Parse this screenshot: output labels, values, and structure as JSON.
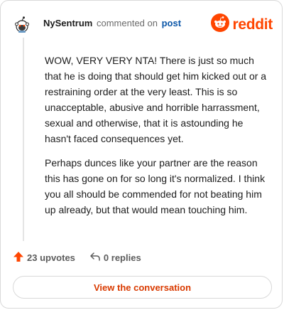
{
  "header": {
    "username": "NySentrum",
    "verb": "commented on",
    "post_link": "post",
    "brand_text": "reddit"
  },
  "comment": {
    "paragraphs": [
      "WOW, VERY VERY NTA! There is just so much that he is doing that should get him kicked out or a restraining order at the very least. This is so unacceptable, abusive and horrible harrassment, sexual and otherwise, that it is astounding he hasn't faced consequences yet.",
      "Perhaps dunces like your partner are the reason this has gone on for so long it's normalized. I think you all should be commended for not beating him up already, but that would mean touching him."
    ]
  },
  "actions": {
    "upvotes": "23 upvotes",
    "replies": "0 replies"
  },
  "footer": {
    "button_label": "View the conversation"
  },
  "colors": {
    "brand": "#ff4500",
    "link": "#0a56a8",
    "button_text": "#d93a00"
  },
  "icons": {
    "avatar": "snoo-avatar-icon",
    "brand": "reddit-logo-icon",
    "upvote": "upvote-arrow-icon",
    "reply": "reply-arrow-icon"
  }
}
